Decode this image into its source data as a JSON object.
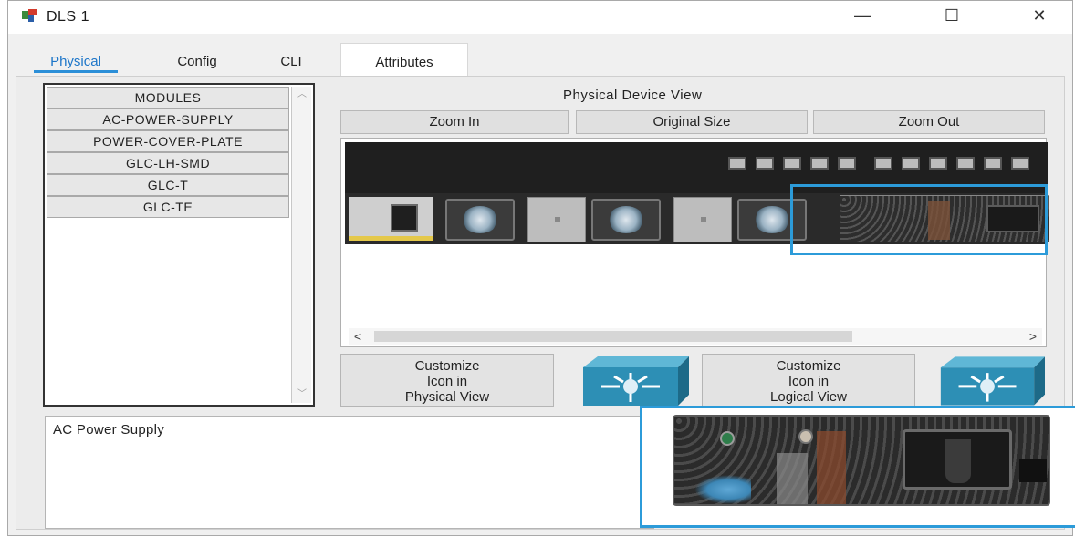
{
  "window": {
    "title": "DLS 1",
    "controls": {
      "minimize": "—",
      "maximize": "☐",
      "close": "✕"
    }
  },
  "tabs": [
    {
      "label": "Physical",
      "active": true
    },
    {
      "label": "Config",
      "active": false
    },
    {
      "label": "CLI",
      "active": false
    },
    {
      "label": "Attributes",
      "active": false
    }
  ],
  "modules": {
    "items": [
      "MODULES",
      "AC-POWER-SUPPLY",
      "POWER-COVER-PLATE",
      "GLC-LH-SMD",
      "GLC-T",
      "GLC-TE"
    ],
    "scroll_up": "︿",
    "scroll_down": "﹀"
  },
  "device_view": {
    "title": "Physical Device View",
    "zoom_in": "Zoom In",
    "original_size": "Original Size",
    "zoom_out": "Zoom Out",
    "scroll_left": "<",
    "scroll_right": ">"
  },
  "customize": {
    "physical": {
      "line1": "Customize",
      "line2": "Icon in",
      "line3": "Physical View"
    },
    "logical": {
      "line1": "Customize",
      "line2": "Icon in",
      "line3": "Logical View"
    }
  },
  "description": {
    "text": "AC Power Supply"
  },
  "colors": {
    "accent": "#2c9bd9",
    "active_tab": "#1d76c9",
    "switch_icon": "#2d8fb5"
  }
}
